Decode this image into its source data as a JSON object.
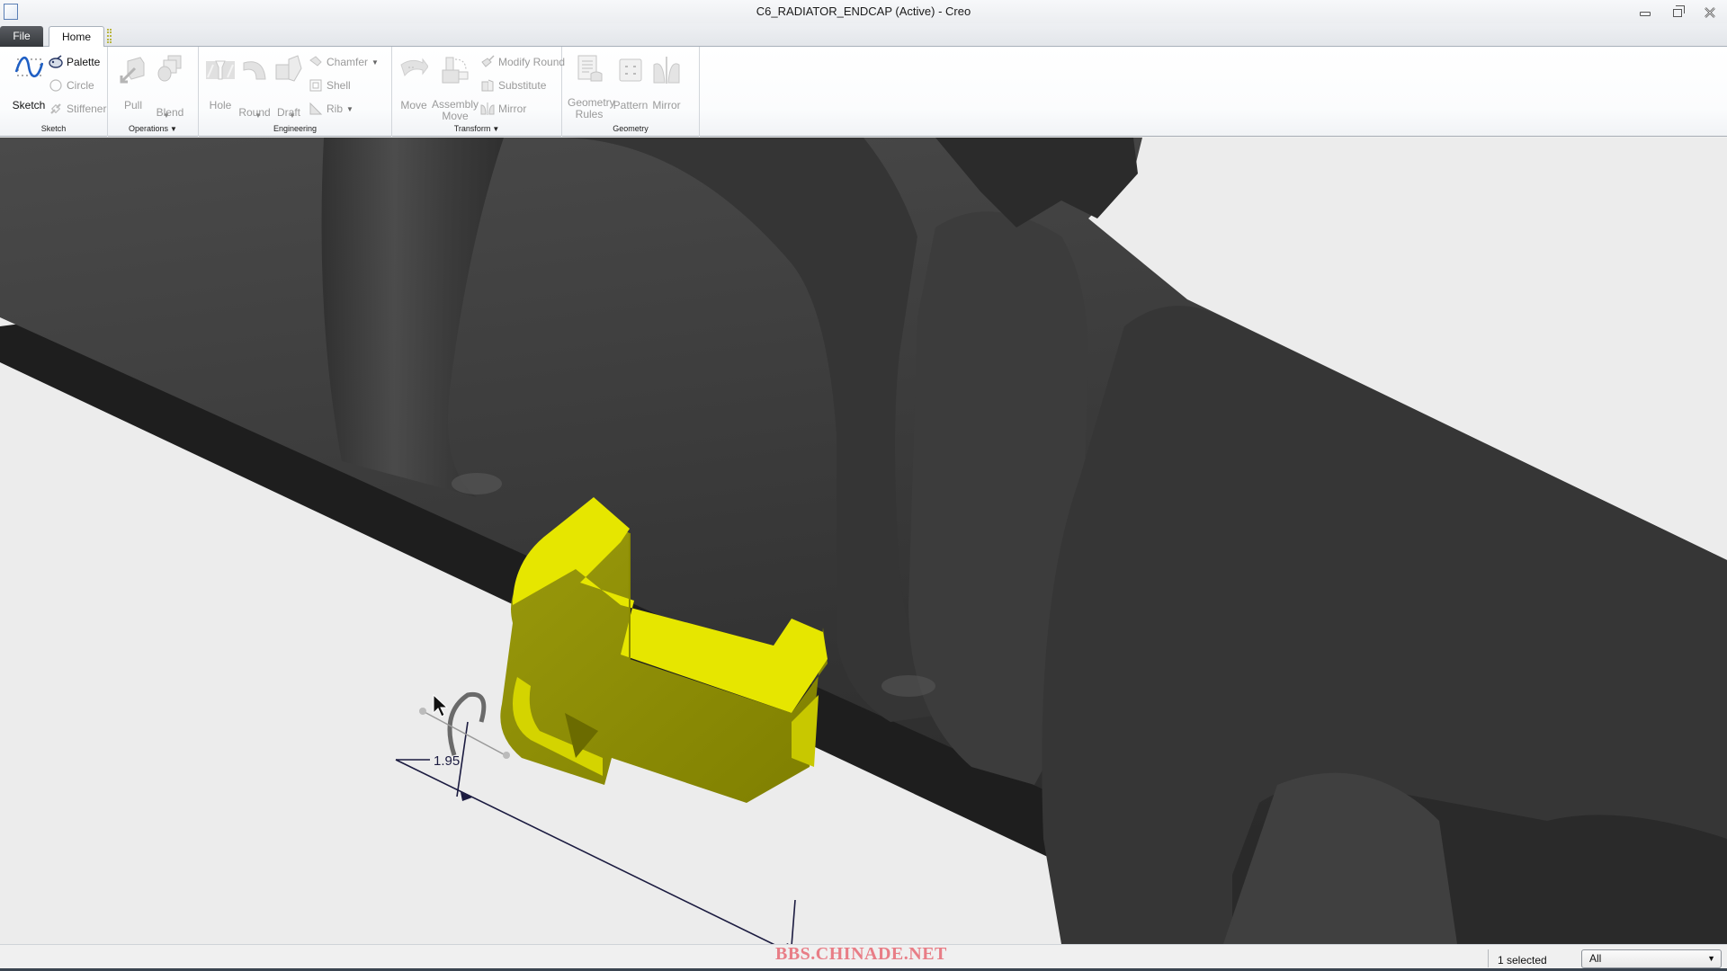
{
  "window": {
    "title": "C6_RADIATOR_ENDCAP (Active) - Creo",
    "icon": "app-window-icon",
    "controls": {
      "minimize": "minimize-icon",
      "maximize": "restore-icon",
      "close": "close-icon"
    }
  },
  "tabs": [
    {
      "label": "File",
      "active": false
    },
    {
      "label": "Home",
      "active": true
    }
  ],
  "help": {
    "icon": "help-icon",
    "glyph": "?",
    "dropdown": "▼"
  },
  "ribbon": {
    "groups": [
      {
        "label": "Sketch",
        "has_dropdown": false,
        "buttons": [
          {
            "label": "Sketch",
            "icon": "sketch-icon",
            "enabled": true
          },
          {
            "label": "Palette",
            "icon": "palette-icon",
            "enabled": true
          },
          {
            "label": "Circle",
            "icon": "circle-icon",
            "enabled": false
          },
          {
            "label": "Stiffener",
            "icon": "stiffener-icon",
            "enabled": false
          }
        ]
      },
      {
        "label": "Operations",
        "has_dropdown": true,
        "buttons": [
          {
            "label": "Pull",
            "icon": "pull-icon",
            "enabled": false
          },
          {
            "label": "Blend",
            "icon": "blend-icon",
            "enabled": false
          }
        ]
      },
      {
        "label": "Engineering",
        "has_dropdown": false,
        "buttons": [
          {
            "label": "Hole",
            "icon": "hole-icon",
            "enabled": false
          },
          {
            "label": "Round",
            "icon": "round-icon",
            "enabled": false
          },
          {
            "label": "Draft",
            "icon": "draft-icon",
            "enabled": false
          },
          {
            "label": "Chamfer",
            "icon": "chamfer-icon",
            "enabled": false
          },
          {
            "label": "Shell",
            "icon": "shell-icon",
            "enabled": false
          },
          {
            "label": "Rib",
            "icon": "rib-icon",
            "enabled": false
          }
        ]
      },
      {
        "label": "Transform",
        "has_dropdown": true,
        "buttons": [
          {
            "label": "Move",
            "icon": "move-icon",
            "enabled": false
          },
          {
            "label": "Assembly Move",
            "line1": "Assembly",
            "line2": "Move",
            "icon": "assembly-move-icon",
            "enabled": false
          },
          {
            "label": "Modify Round",
            "icon": "modify-round-icon",
            "enabled": false
          },
          {
            "label": "Substitute",
            "icon": "substitute-icon",
            "enabled": false
          },
          {
            "label": "Mirror",
            "icon": "mirror-icon",
            "enabled": false
          }
        ]
      },
      {
        "label": "Geometry",
        "has_dropdown": false,
        "buttons": [
          {
            "label": "Geometry Rules",
            "line1": "Geometry",
            "line2": "Rules",
            "icon": "geometry-rules-icon",
            "enabled": false
          },
          {
            "label": "Pattern",
            "icon": "pattern-icon",
            "enabled": false
          },
          {
            "label": "Mirror",
            "icon": "mirror-icon",
            "enabled": false
          }
        ]
      }
    ]
  },
  "viewport": {
    "model": "C6_RADIATOR_ENDCAP",
    "selected_part_color": "#e6e600",
    "model_color": "#3a3a3a",
    "background_color": "#ececec",
    "dimension_value": "1.95"
  },
  "statusbar": {
    "watermark": "BBS.CHINADE.NET",
    "selection_text": "1 selected",
    "filter_value": "All",
    "filter_arrow": "▼"
  }
}
